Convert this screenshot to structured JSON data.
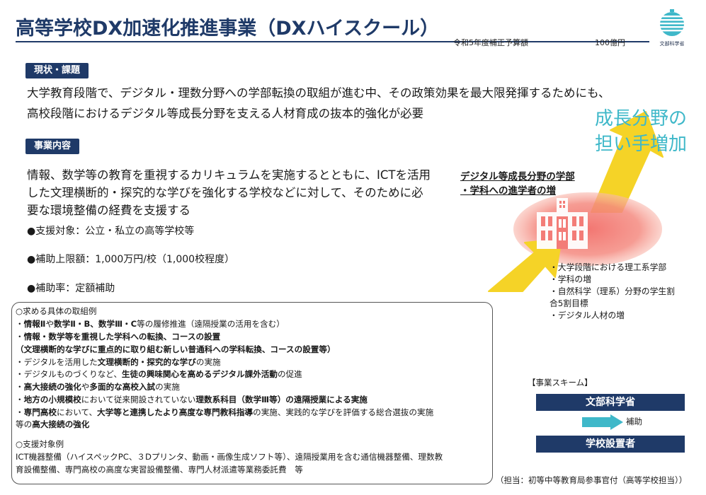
{
  "header": {
    "title": "高等学校DX加速化推進事業（DXハイスクール）",
    "budget_label": "令和5年度補正予算額",
    "budget_value": "100億円",
    "ministry_logo_text": "文部科学省"
  },
  "status": {
    "label": "現状・課題",
    "lines": [
      "大学教育段階で、デジタル・理数分野への学部転換の取組が進む中、その政策効果を最大限発揮するためにも、",
      "高校段階におけるデジタル等成長分野を支える人材育成の抜本的強化が必要"
    ]
  },
  "content": {
    "label": "事業内容",
    "lines": [
      "情報、数学等の教育を重視するカリキュラムを実施するとともに、ICTを活用",
      "した文理横断的・探究的な学びを強化する学校などに対して、そのために必",
      "要な環境整備の経費を支援する"
    ],
    "bullets": [
      "●支援対象：公立・私立の高等学校等",
      "●補助上限額：1,000万円/校（1,000校程度）",
      "●補助率：定額補助"
    ]
  },
  "examples": {
    "heading": "○求める具体の取組例",
    "items": [
      [
        "・",
        "情報Ⅱ",
        "や",
        "数学Ⅱ・B、数学Ⅲ・C",
        "等の履修推進（遠隔授業の活用を含む）"
      ],
      [
        "・",
        "情報・数学等を重視した学科への転換、コースの設置",
        "",
        "",
        ""
      ],
      [
        "",
        "（文理横断的な学びに重点的に取り組む新しい普通科への学科転換、コースの設置等）",
        "",
        "",
        ""
      ],
      [
        "・デジタルを活用した",
        "文理横断的・探究的な学び",
        "の実施",
        "",
        ""
      ],
      [
        "・デジタルものづくりなど、",
        "生徒の興味関心を高めるデジタル課外活動",
        "の促進",
        "",
        ""
      ],
      [
        "・",
        "高大接続の強化",
        "や",
        "多面的な高校入試",
        "の実施"
      ],
      [
        "・",
        "地方の小規模校",
        "において従来開設されていない",
        "理数系科目（数学Ⅲ等）の遠隔授業による実施",
        ""
      ],
      [
        "・",
        "専門高校",
        "において、",
        "大学等と連携したより高度な専門教科指導",
        "の実施、実践的な学びを評価する総合選抜の実施"
      ],
      [
        "等の",
        "高大接続の強化",
        "",
        "",
        ""
      ]
    ],
    "support_heading": "○支援対象例",
    "support_lines": [
      "ICT機器整備（ハイスペックPC、３Dプリンタ、動画・画像生成ソフト等）、遠隔授業用を含む通信機器整備、理数教",
      "育設備整備、専門高校の高度な実習設備整備、専門人材派遣等業務委託費　等"
    ]
  },
  "figure": {
    "growth_label_line1": "成長分野の",
    "growth_label_line2": "担い手増加",
    "digital_heading_line1": "デジタル等成長分野の学部",
    "digital_heading_line2": "・学科への進学者の増",
    "effects": [
      "・大学段階における理工系学部",
      "・学科の増",
      "・自然科学（理系）分野の学生割",
      "合5割目標",
      "・デジタル人材の増"
    ],
    "colors": {
      "arrow": "#f5d327",
      "ellipse": "#f26f6a",
      "growth_text": "#3fb8c9",
      "navy": "#1f3a68"
    }
  },
  "scheme": {
    "label": "【事業スキーム】",
    "top": "文部科学省",
    "assist": "補助",
    "bottom": "学校設置者"
  },
  "contact": "（担当：初等中等教育局参事官付（高等学校担当））"
}
